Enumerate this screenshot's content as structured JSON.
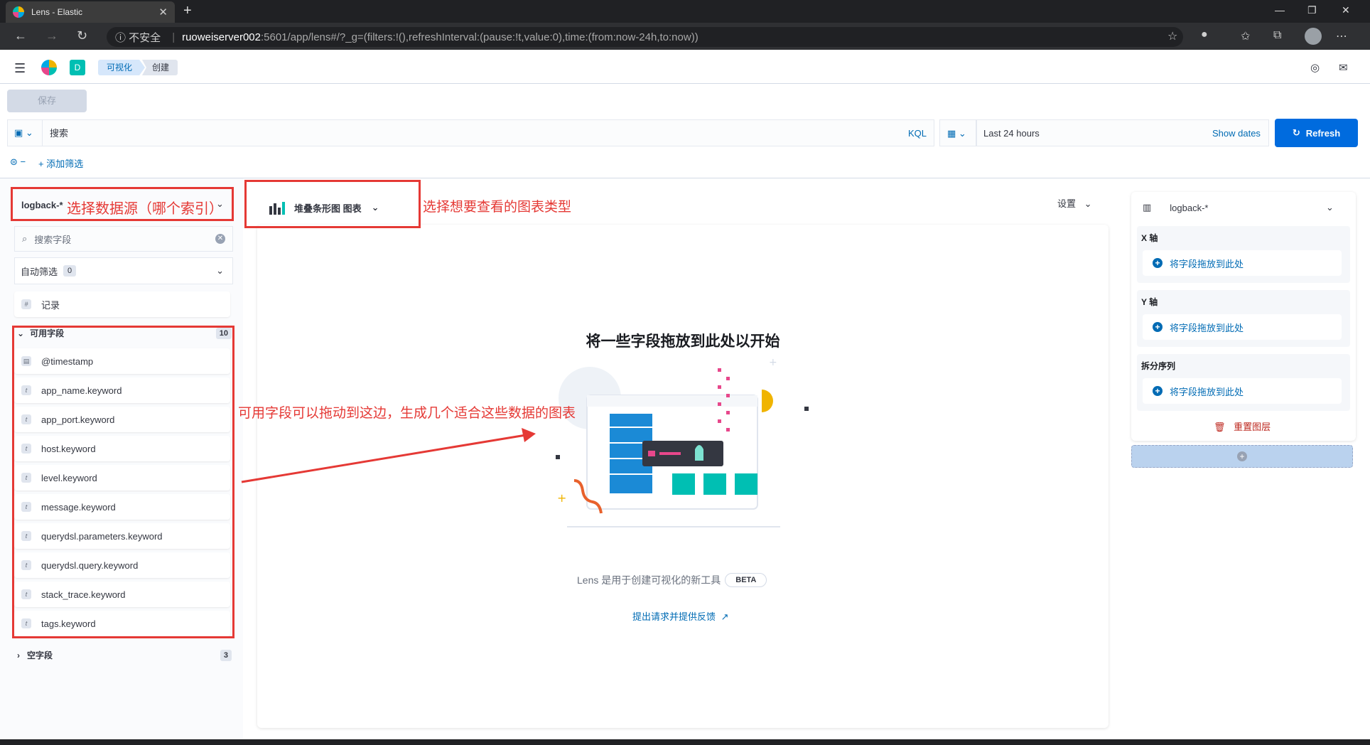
{
  "browser": {
    "tab_title": "Lens - Elastic",
    "tab_close": "✕",
    "new_tab": "+",
    "insecure_label": "不安全",
    "url_host": "ruoweiserver002",
    "url_path": ":5601/app/lens#/?_g=(filters:!(),refreshInterval:(pause:!t,value:0),time:(from:now-24h,to:now))"
  },
  "header": {
    "space_letter": "D",
    "breadcrumbs": [
      "可视化",
      "创建"
    ]
  },
  "toolbar": {
    "save_label": "保存",
    "search_placeholder": "搜索",
    "kql_label": "KQL",
    "date_range": "Last 24 hours",
    "show_dates": "Show dates",
    "refresh_label": "Refresh",
    "add_filter": "+ 添加筛选"
  },
  "left_panel": {
    "index_pattern": "logback-*",
    "field_search_placeholder": "搜索字段",
    "auto_filter_label": "自动筛选",
    "auto_filter_count": "0",
    "records_field": "记录",
    "available_label": "可用字段",
    "available_count": "10",
    "available_fields": [
      {
        "name": "@timestamp",
        "type": "date"
      },
      {
        "name": "app_name.keyword",
        "type": "t"
      },
      {
        "name": "app_port.keyword",
        "type": "t"
      },
      {
        "name": "host.keyword",
        "type": "t"
      },
      {
        "name": "level.keyword",
        "type": "t"
      },
      {
        "name": "message.keyword",
        "type": "t"
      },
      {
        "name": "querydsl.parameters.keyword",
        "type": "t"
      },
      {
        "name": "querydsl.query.keyword",
        "type": "t"
      },
      {
        "name": "stack_trace.keyword",
        "type": "t"
      },
      {
        "name": "tags.keyword",
        "type": "t"
      }
    ],
    "empty_label": "空字段",
    "empty_count": "3"
  },
  "center": {
    "chart_type_label": "堆叠条形图 图表",
    "settings_label": "设置",
    "empty_title": "将一些字段拖放到此处以开始",
    "lens_desc": "Lens 是用于创建可视化的新工具",
    "beta_label": "BETA",
    "feedback_link": "提出请求并提供反馈"
  },
  "right_panel": {
    "index_pattern": "logback-*",
    "x_axis": "X 轴",
    "y_axis": "Y 轴",
    "split_series": "拆分序列",
    "drop_hint": "将字段拖放到此处",
    "reset_layer": "重置图层"
  },
  "annotations": {
    "datasource": "选择数据源（哪个索引）",
    "chart_type": "选择想要查看的图表类型",
    "fields_hint": "可用字段可以拖动到这边，生成几个适合这些数据的图表"
  },
  "colors": {
    "accent": "#006bde",
    "link": "#006bb4",
    "annotation": "#e53935",
    "danger": "#bd271e"
  }
}
